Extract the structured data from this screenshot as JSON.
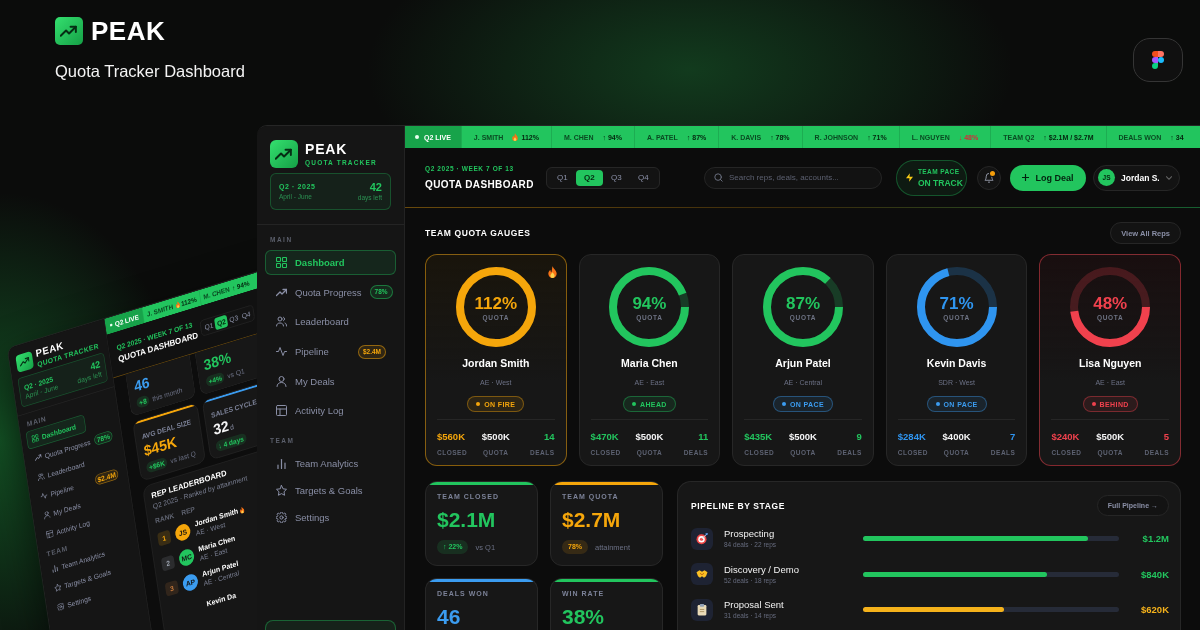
{
  "hero": {
    "brand": "PEAK",
    "subtitle": "Quota Tracker Dashboard"
  },
  "preview": {
    "sidebar": {
      "brand": "PEAK",
      "tagline": "QUOTA TRACKER",
      "period": {
        "quarter": "Q2 · 2025",
        "months": "April - June",
        "days": "42",
        "days_label": "days left"
      },
      "sections": [
        {
          "title": "MAIN",
          "items": [
            {
              "label": "Dashboard",
              "selected": true
            },
            {
              "label": "Quota Progress",
              "selected": false,
              "badge": {
                "text": "78%",
                "kind": "positive"
              }
            },
            {
              "label": "Leaderboard",
              "selected": false
            },
            {
              "label": "Pipeline",
              "selected": false,
              "badge": {
                "text": "$2.4M",
                "kind": "warning"
              }
            },
            {
              "label": "My Deals",
              "selected": false
            },
            {
              "label": "Activity Log",
              "selected": false
            }
          ]
        },
        {
          "title": "TEAM",
          "items": [
            {
              "label": "Team Analytics",
              "selected": false
            },
            {
              "label": "Targets & Goals",
              "selected": false
            },
            {
              "label": "Settings",
              "selected": false
            }
          ]
        }
      ]
    },
    "ticker": {
      "live": "Q2 LIVE",
      "items": [
        {
          "name": "J. SMITH",
          "value": "112%",
          "kind": "fire"
        },
        {
          "name": "M. CHEN",
          "value": "↑ 94%",
          "kind": "up"
        }
      ]
    },
    "header": {
      "eyebrow": "Q2 2025 · WEEK 7 OF 13",
      "title": "QUOTA DASHBOARD",
      "quarters": [
        {
          "label": "Q1",
          "selected": false
        },
        {
          "label": "Q2",
          "selected": true
        },
        {
          "label": "Q3",
          "selected": false
        },
        {
          "label": "Q4",
          "selected": false
        }
      ]
    },
    "stats": [
      {
        "value": "46",
        "color": "#3b9cf0",
        "kind": "accent",
        "delta": {
          "text": "+8",
          "kind": "positive"
        },
        "note": "this month"
      },
      {
        "value": "38%",
        "color": "#22c55e",
        "kind": "accent",
        "delta": {
          "text": "+4%",
          "kind": "positive"
        },
        "note": "vs Q1"
      },
      {
        "label": "AVG DEAL SIZE",
        "value": "$45K",
        "color": "#f5a60b",
        "kind": "accent",
        "delta": {
          "text": "+$6K",
          "kind": "positive"
        },
        "note": "vs last Q"
      },
      {
        "label": "SALES CYCLE",
        "value": "32",
        "unit": "d",
        "color": "#3b9cf0",
        "kind": "plain",
        "delta": {
          "text": "↓ 4 days",
          "kind": "positive"
        }
      }
    ],
    "leaderboard": {
      "title": "REP LEADERBOARD",
      "subtitle": "Q2 2025 · Ranked by attainment",
      "columns": [
        "RANK",
        "REP"
      ],
      "rows": [
        {
          "rank": "1",
          "initials": "JS",
          "name": "Jordan Smith",
          "role": "AE · West",
          "color": "#f5a60b",
          "flame": true
        },
        {
          "rank": "2",
          "initials": "MC",
          "name": "Maria Chen",
          "role": "AE · East",
          "color": "#22c55e",
          "flame": false
        },
        {
          "rank": "3",
          "initials": "AP",
          "name": "Arjun Patel",
          "role": "AE · Central",
          "color": "#3b9cf0",
          "flame": false
        },
        {
          "name": "Kevin Da",
          "flame": false
        }
      ]
    }
  },
  "sidebar": {
    "brand": "PEAK",
    "tagline": "QUOTA TRACKER",
    "period": {
      "quarter": "Q2 · 2025",
      "months": "April - June",
      "days": "42",
      "days_label": "days left"
    },
    "sections": [
      {
        "title": "MAIN",
        "items": [
          {
            "label": "Dashboard",
            "selected": true
          },
          {
            "label": "Quota Progress",
            "selected": false,
            "badge": {
              "text": "78%",
              "kind": "positive"
            }
          },
          {
            "label": "Leaderboard",
            "selected": false
          },
          {
            "label": "Pipeline",
            "selected": false,
            "badge": {
              "text": "$2.4M",
              "kind": "warning"
            }
          },
          {
            "label": "My Deals",
            "selected": false
          },
          {
            "label": "Activity Log",
            "selected": false
          }
        ]
      },
      {
        "title": "TEAM",
        "items": [
          {
            "label": "Team Analytics",
            "selected": false
          },
          {
            "label": "Targets & Goals",
            "selected": false
          },
          {
            "label": "Settings",
            "selected": false
          }
        ]
      }
    ]
  },
  "ticker": {
    "live": "Q2 LIVE",
    "items": [
      {
        "name": "J. SMITH",
        "value": "112%",
        "kind": "fire"
      },
      {
        "name": "M. CHEN",
        "value": "↑ 94%",
        "kind": "up"
      },
      {
        "name": "A. PATEL",
        "value": "↑ 87%",
        "kind": "up"
      },
      {
        "name": "K. DAVIS",
        "value": "↑ 78%",
        "kind": "up"
      },
      {
        "name": "R. JOHNSON",
        "value": "↑ 71%",
        "kind": "up"
      },
      {
        "name": "L. NGUYEN",
        "value": "↓ 48%",
        "kind": "down"
      },
      {
        "name": "TEAM Q2",
        "value": "↑ $2.1M / $2.7M",
        "kind": "up"
      },
      {
        "name": "DEALS WON",
        "value": "↑ 34",
        "kind": "up"
      }
    ]
  },
  "header": {
    "eyebrow": "Q2 2025 · WEEK 7 OF 13",
    "title": "QUOTA DASHBOARD",
    "quarters": [
      {
        "label": "Q1",
        "selected": false
      },
      {
        "label": "Q2",
        "selected": true
      },
      {
        "label": "Q3",
        "selected": false
      },
      {
        "label": "Q4",
        "selected": false
      }
    ],
    "search": {
      "placeholder": "Search reps, deals, accounts..."
    },
    "pace": {
      "label": "TEAM PACE",
      "status": "ON TRACK"
    },
    "notifications": {
      "unread": true
    },
    "action": "Log Deal",
    "user": {
      "initials": "JS",
      "name": "Jordan S."
    }
  },
  "gauges": {
    "title": "TEAM QUOTA GAUGES",
    "action": "View All Reps",
    "reps": [
      {
        "name": "Jordan Smith",
        "role": "AE · West",
        "percent": "112%",
        "caption": "QUOTA",
        "level": 1,
        "color": "#f5a60b",
        "status": {
          "text": "ON FIRE",
          "color": "#f5a60b"
        },
        "highlighted": true,
        "flame": true,
        "stats": [
          {
            "value": "$560K",
            "label": "CLOSED",
            "kind": "accent"
          },
          {
            "value": "$500K",
            "label": "QUOTA",
            "kind": "plain"
          },
          {
            "value": "14",
            "label": "DEALS",
            "kind": "positive"
          }
        ]
      },
      {
        "name": "Maria Chen",
        "role": "AE · East",
        "percent": "94%",
        "caption": "QUOTA",
        "level": 0.94,
        "color": "#22c55e",
        "status": {
          "text": "AHEAD",
          "color": "#22c55e"
        },
        "highlighted": false,
        "flame": false,
        "stats": [
          {
            "value": "$470K",
            "label": "CLOSED",
            "kind": "accent"
          },
          {
            "value": "$500K",
            "label": "QUOTA",
            "kind": "plain"
          },
          {
            "value": "11",
            "label": "DEALS",
            "kind": "accent"
          }
        ]
      },
      {
        "name": "Arjun Patel",
        "role": "AE · Central",
        "percent": "87%",
        "caption": "QUOTA",
        "level": 0.87,
        "color": "#22c55e",
        "status": {
          "text": "ON PACE",
          "color": "#3b9cf0"
        },
        "highlighted": false,
        "flame": false,
        "stats": [
          {
            "value": "$435K",
            "label": "CLOSED",
            "kind": "accent"
          },
          {
            "value": "$500K",
            "label": "QUOTA",
            "kind": "plain"
          },
          {
            "value": "9",
            "label": "DEALS",
            "kind": "accent"
          }
        ]
      },
      {
        "name": "Kevin Davis",
        "role": "SDR · West",
        "percent": "71%",
        "caption": "QUOTA",
        "level": 0.71,
        "color": "#2f95f0",
        "status": {
          "text": "ON PACE",
          "color": "#3b9cf0"
        },
        "highlighted": false,
        "flame": false,
        "stats": [
          {
            "value": "$284K",
            "label": "CLOSED",
            "kind": "accent"
          },
          {
            "value": "$400K",
            "label": "QUOTA",
            "kind": "plain"
          },
          {
            "value": "7",
            "label": "DEALS",
            "kind": "accent"
          }
        ]
      },
      {
        "name": "Lisa Nguyen",
        "role": "AE · East",
        "percent": "48%",
        "caption": "QUOTA",
        "level": 0.48,
        "color": "#f0414d",
        "status": {
          "text": "BEHIND",
          "color": "#f0414d"
        },
        "highlighted": true,
        "flame": false,
        "stats": [
          {
            "value": "$240K",
            "label": "CLOSED",
            "kind": "accent"
          },
          {
            "value": "$500K",
            "label": "QUOTA",
            "kind": "plain"
          },
          {
            "value": "5",
            "label": "DEALS",
            "kind": "accent"
          }
        ]
      }
    ]
  },
  "stats": [
    {
      "label": "TEAM CLOSED",
      "value": "$2.1M",
      "color": "#22c55e",
      "delta": {
        "text": "↑ 22%",
        "kind": "positive"
      },
      "note": "vs Q1"
    },
    {
      "label": "TEAM QUOTA",
      "value": "$2.7M",
      "color": "#f5a60b",
      "delta": {
        "text": "78%",
        "kind": "accent"
      },
      "note": "attainment"
    },
    {
      "label": "DEALS WON",
      "value": "46",
      "color": "#3b9cf0"
    },
    {
      "label": "WIN RATE",
      "value": "38%",
      "color": "#22c55e"
    }
  ],
  "pipeline": {
    "title": "PIPELINE BY STAGE",
    "action": "Full Pipeline →",
    "stages": [
      {
        "name": "Prospecting",
        "meta": "84 deals · 22 reps",
        "level": 0.88,
        "color": "#22c55e",
        "amount": "$1.2M"
      },
      {
        "name": "Discovery / Demo",
        "meta": "52 deals · 18 reps",
        "level": 0.72,
        "color": "#22c55e",
        "amount": "$840K"
      },
      {
        "name": "Proposal Sent",
        "meta": "31 deals · 14 reps",
        "level": 0.55,
        "color": "#f5b21b",
        "amount": "$620K"
      }
    ]
  }
}
